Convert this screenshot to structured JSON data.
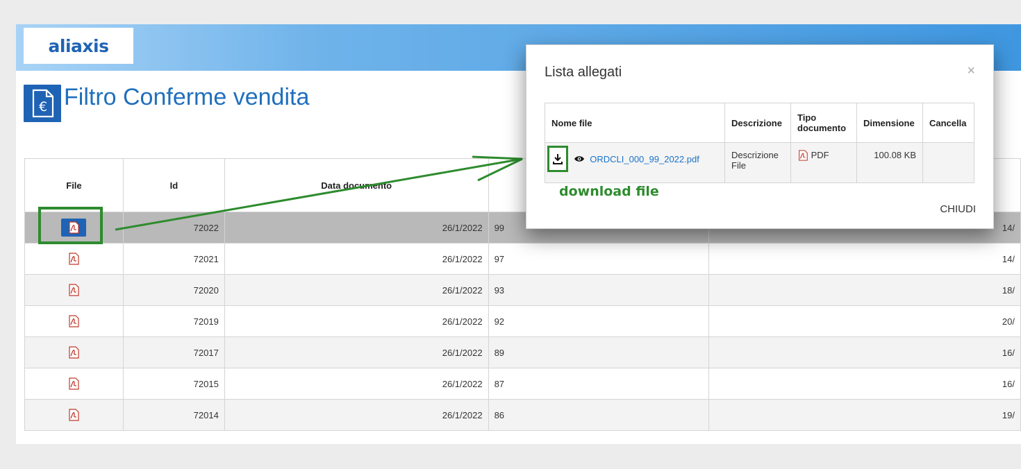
{
  "header": {
    "logo_text": "aliaxis",
    "page_title": "Filtro Conferme vendita",
    "brand_color": "#1f63b5"
  },
  "table": {
    "columns": [
      "File",
      "Id",
      "Data documento"
    ],
    "rows": [
      {
        "id": "72022",
        "date": "26/1/2022",
        "num": "99",
        "tail": "14/",
        "selected": true
      },
      {
        "id": "72021",
        "date": "26/1/2022",
        "num": "97",
        "tail": "14/"
      },
      {
        "id": "72020",
        "date": "26/1/2022",
        "num": "93",
        "tail": "18/"
      },
      {
        "id": "72019",
        "date": "26/1/2022",
        "num": "92",
        "tail": "20/"
      },
      {
        "id": "72017",
        "date": "26/1/2022",
        "num": "89",
        "tail": "16/"
      },
      {
        "id": "72015",
        "date": "26/1/2022",
        "num": "87",
        "tail": "16/"
      },
      {
        "id": "72014",
        "date": "26/1/2022",
        "num": "86",
        "tail": "19/"
      }
    ]
  },
  "modal": {
    "title": "Lista allegati",
    "close_glyph": "×",
    "columns": [
      "Nome file",
      "Descrizione",
      "Tipo documento",
      "Dimensione",
      "Cancella"
    ],
    "attachment": {
      "file_name": "ORDCLI_000_99_2022.pdf",
      "description": "Descrizione File",
      "doc_type": "PDF",
      "size": "100.08 KB"
    },
    "annotation": "download file",
    "close_button": "CHIUDI"
  },
  "icons": {
    "pdf": "pdf-file-icon",
    "download": "download-icon",
    "view": "eye-icon",
    "doc_euro": "document-euro-icon"
  },
  "colors": {
    "highlight_green": "#2e8b2e",
    "link_blue": "#1a73c9",
    "selected_row": "#b9b9b9"
  }
}
